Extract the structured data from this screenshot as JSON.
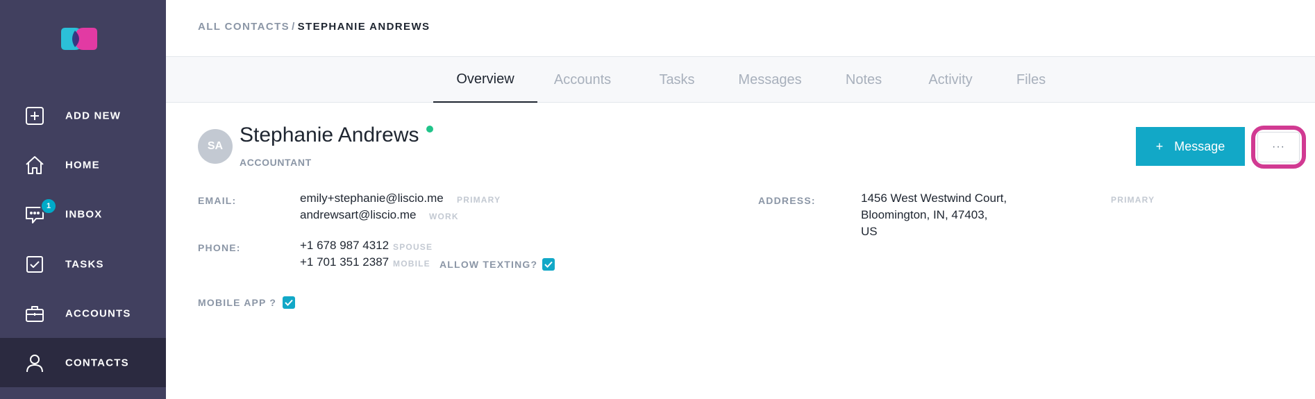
{
  "sidebar": {
    "logo_name": "liscio-logo",
    "items": [
      {
        "label": "ADD NEW",
        "icon": "plus-square-icon"
      },
      {
        "label": "HOME",
        "icon": "home-icon"
      },
      {
        "label": "INBOX",
        "icon": "chat-icon",
        "badge": "1"
      },
      {
        "label": "TASKS",
        "icon": "checkbox-icon"
      },
      {
        "label": "ACCOUNTS",
        "icon": "briefcase-icon"
      },
      {
        "label": "CONTACTS",
        "icon": "user-icon",
        "active": true
      }
    ]
  },
  "breadcrumb": {
    "parent": "ALL CONTACTS",
    "separator": "/",
    "current": "STEPHANIE ANDREWS"
  },
  "tabs": [
    {
      "label": "Overview",
      "active": true
    },
    {
      "label": "Accounts"
    },
    {
      "label": "Tasks"
    },
    {
      "label": "Messages"
    },
    {
      "label": "Notes"
    },
    {
      "label": "Activity"
    },
    {
      "label": "Files"
    }
  ],
  "contact": {
    "initials": "SA",
    "name": "Stephanie Andrews",
    "role": "ACCOUNTANT",
    "status": "online"
  },
  "actions": {
    "message_icon": "+",
    "message_label": "Message",
    "more_label": "···"
  },
  "details": {
    "email_label": "EMAIL:",
    "emails": [
      {
        "value": "emily+stephanie@liscio.me",
        "tag": "PRIMARY"
      },
      {
        "value": "andrewsart@liscio.me",
        "tag": "WORK"
      }
    ],
    "phone_label": "PHONE:",
    "phones": [
      {
        "value": "+1 678 987 4312",
        "tag": "SPOUSE"
      },
      {
        "value": "+1 701 351 2387",
        "tag": "MOBILE"
      }
    ],
    "allow_texting_label": "ALLOW TEXTING?",
    "allow_texting": true,
    "mobile_app_label": "MOBILE APP ?",
    "mobile_app": true,
    "address_label": "ADDRESS:",
    "address_lines": [
      "1456 West Westwind Court,",
      "Bloomington, IN, 47403,",
      "US"
    ],
    "address_tag": "PRIMARY"
  },
  "colors": {
    "sidebar_bg": "#41405f",
    "sidebar_active": "#2b2a40",
    "accent": "#12a8c7",
    "highlight": "#d13a92",
    "online": "#21c48a"
  }
}
